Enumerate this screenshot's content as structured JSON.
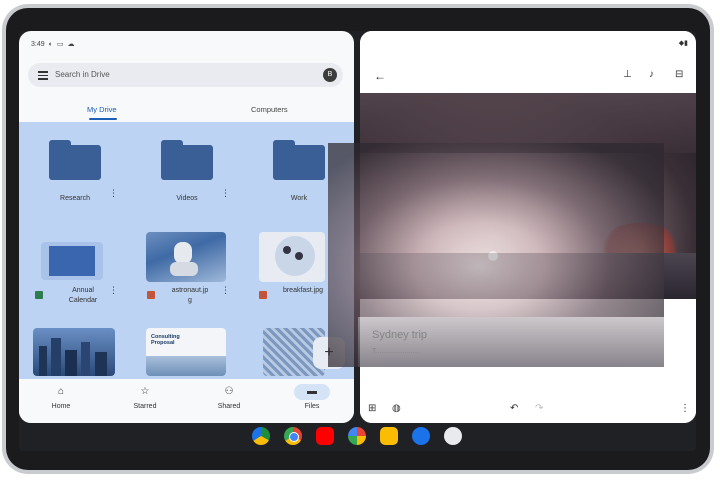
{
  "status": {
    "time": "3:49"
  },
  "left_app": {
    "search_placeholder": "Search in Drive",
    "avatar_initial": "B",
    "tabs": [
      "My Drive",
      "Computers"
    ],
    "folders": [
      {
        "name": "Research"
      },
      {
        "name": "Videos"
      },
      {
        "name": "Work"
      }
    ],
    "files": [
      {
        "name": "Annual Calendar",
        "line1": "Annual",
        "line2": "Calendar"
      },
      {
        "name": "astronaut.jpg",
        "line1": "astronaut.jp",
        "line2": "g"
      },
      {
        "name": "breakfast.jpg",
        "line1": "breakfast.jpg",
        "line2": ""
      }
    ],
    "thumb_texts": {
      "proposal": "Consulting Proposal"
    },
    "bottom_nav": [
      {
        "label": "Home",
        "icon": "home-icon"
      },
      {
        "label": "Starred",
        "icon": "star-icon"
      },
      {
        "label": "Shared",
        "icon": "people-icon"
      },
      {
        "label": "Files",
        "icon": "folder-icon"
      }
    ]
  },
  "right_app": {
    "note_title": "Sydney trip",
    "note_body": "T......................"
  },
  "dock": [
    "Google Drive",
    "Chrome",
    "YouTube",
    "Photos",
    "Keep",
    "Messages",
    "App drawer"
  ],
  "colors": {
    "accent": "#1a5fb4",
    "folder": "#3a5f97",
    "selection": "#bcd3f3"
  }
}
